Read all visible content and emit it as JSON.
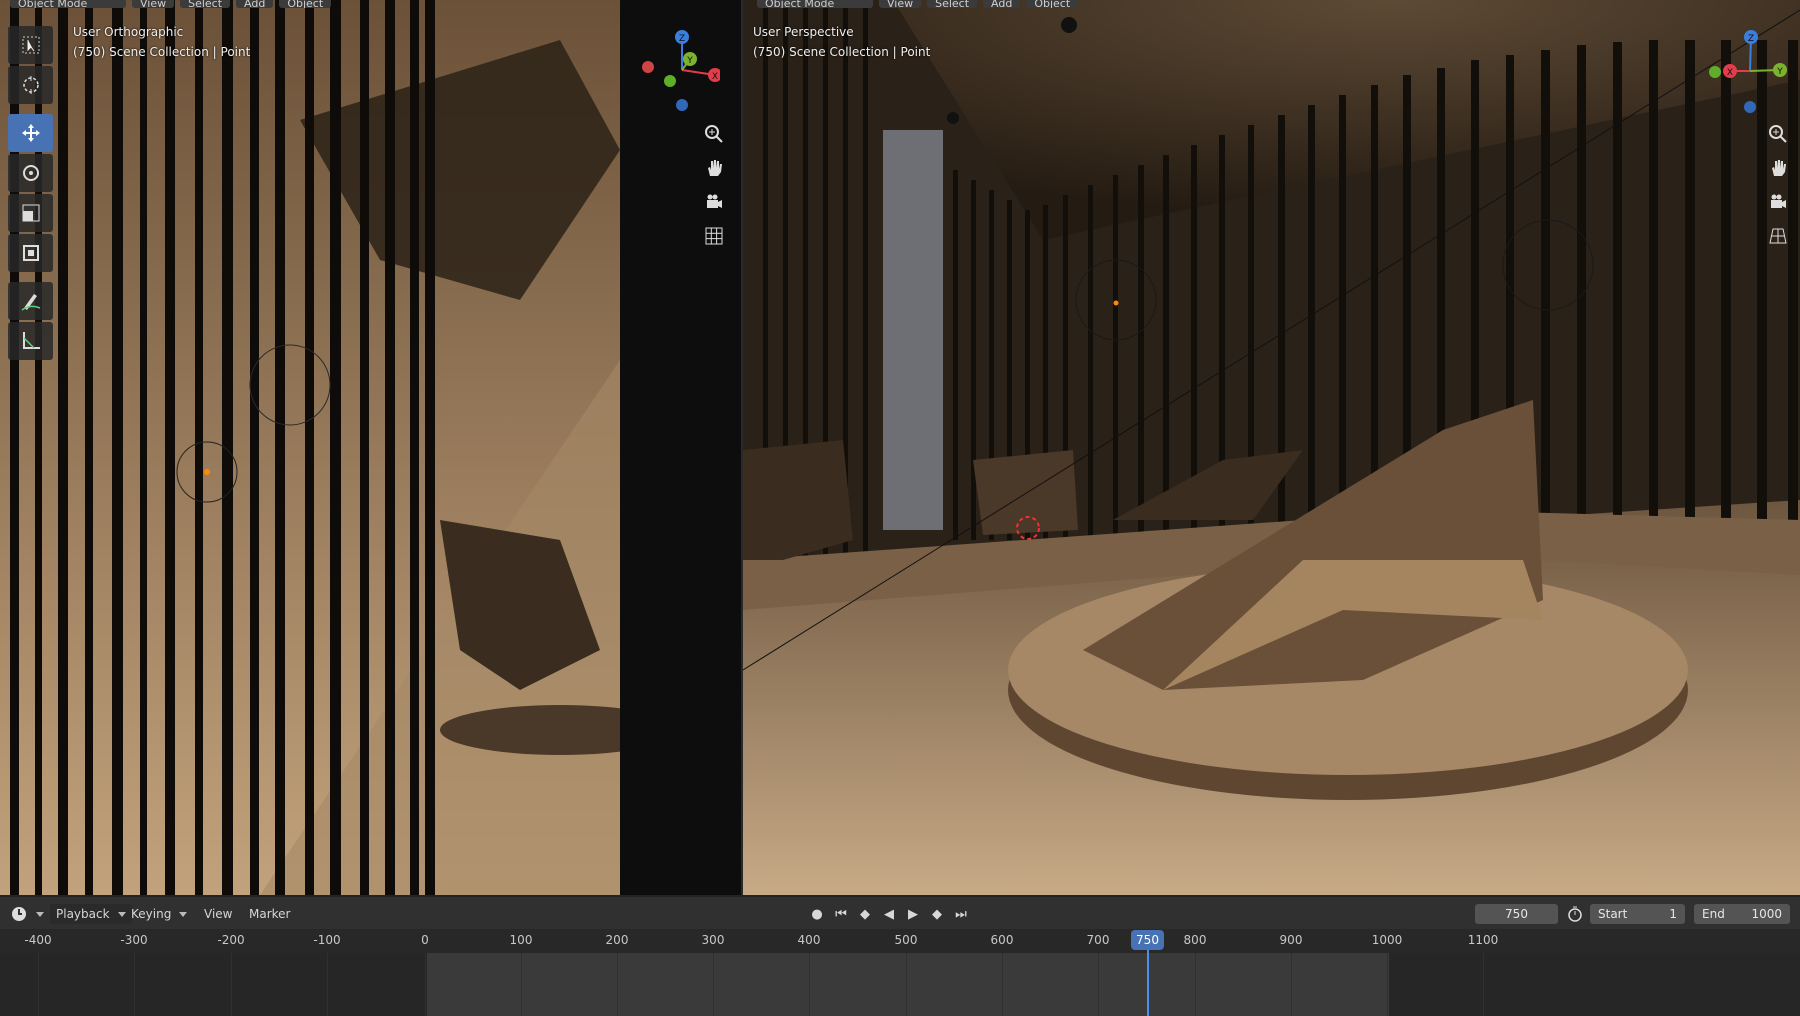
{
  "left_viewport": {
    "mode": "Object Mode",
    "menu": [
      "View",
      "Select",
      "Add",
      "Object"
    ],
    "view_name": "User Orthographic",
    "collection_info": "(750) Scene Collection | Point"
  },
  "right_viewport": {
    "mode": "Object Mode",
    "menu": [
      "View",
      "Select",
      "Add",
      "Object"
    ],
    "view_name": "User Perspective",
    "collection_info": "(750) Scene Collection | Point"
  },
  "toolbar": {
    "tools": [
      "select-box-icon",
      "cursor-icon",
      "move-icon",
      "rotate-icon",
      "scale-icon",
      "transform-icon",
      "annotate-icon",
      "measure-icon"
    ],
    "active_tool": "move-icon"
  },
  "gizmo_left": {
    "axes": [
      "Z",
      "Y",
      "X"
    ]
  },
  "gizmo_right": {
    "axes": [
      "Z",
      "X",
      "Y"
    ]
  },
  "timeline": {
    "menus": [
      "Playback",
      "Keying",
      "View",
      "Marker"
    ],
    "current_frame": "750",
    "start_label": "Start",
    "start_value": "1",
    "end_label": "End",
    "end_value": "1000",
    "ruler_ticks": [
      "-400",
      "-300",
      "-200",
      "-100",
      "0",
      "100",
      "200",
      "300",
      "400",
      "500",
      "600",
      "700",
      "750",
      "800",
      "900",
      "1000",
      "1100"
    ]
  },
  "colors": {
    "accent": "#4772b3",
    "header_bg": "#303030",
    "playhead": "#4f8ff0"
  }
}
